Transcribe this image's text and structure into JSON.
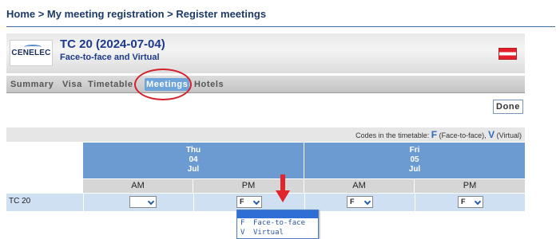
{
  "breadcrumb": "Home > My meeting registration > Register meetings",
  "header": {
    "logo_text": "CENELEC",
    "title": "TC 20 (2024-07-04)",
    "subtitle": "Face-to-face and Virtual"
  },
  "tabs": [
    {
      "label": "Summary",
      "active": false
    },
    {
      "label": "Visa",
      "active": false
    },
    {
      "label": "Timetable",
      "active": false
    },
    {
      "label": "Meetings",
      "active": true
    },
    {
      "label": "Hotels",
      "active": false
    }
  ],
  "done_label": "Done",
  "codes": {
    "prefix": "Codes in the timetable:",
    "f_code": "F",
    "f_desc": "(Face-to-face),",
    "v_code": "V",
    "v_desc": "(Virtual)"
  },
  "days": [
    {
      "weekday": "Thu",
      "day": "04",
      "month": "Jul"
    },
    {
      "weekday": "Fri",
      "day": "05",
      "month": "Jul"
    }
  ],
  "halves": [
    "AM",
    "PM",
    "AM",
    "PM"
  ],
  "row": {
    "label": "TC 20",
    "selections": [
      "",
      "F",
      "F",
      "F"
    ]
  },
  "dropdown_options": [
    {
      "code": "F",
      "label": "Face-to-face"
    },
    {
      "code": "V",
      "label": "Virtual"
    }
  ],
  "colors": {
    "accent": "#6b9bd1",
    "highlight": "#d4202a",
    "title_blue": "#1d3a8a"
  }
}
